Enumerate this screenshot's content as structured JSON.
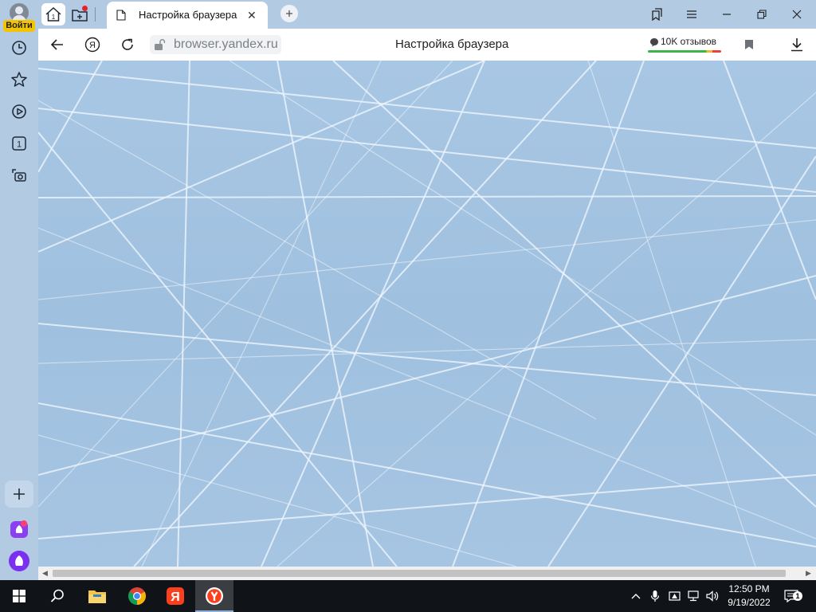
{
  "sidebar": {
    "login_label": "Войти",
    "items": [
      {
        "name": "history-icon"
      },
      {
        "name": "bookmarks-star-icon"
      },
      {
        "name": "play-icon"
      },
      {
        "name": "tabs-counter-icon",
        "label": "1"
      },
      {
        "name": "screenshot-camera-icon"
      }
    ],
    "bottom_items": [
      {
        "name": "add-icon"
      },
      {
        "name": "yandex-messenger-icon"
      },
      {
        "name": "alice-icon"
      }
    ]
  },
  "tabstrip": {
    "active_tab": {
      "title": "Настройка браузера",
      "icon": "page-icon"
    },
    "icons": [
      "home-icon",
      "new-tab-group-icon",
      "new-tab-icon"
    ]
  },
  "window_controls": [
    "collections-icon",
    "menu-icon",
    "minimize-icon",
    "restore-icon",
    "close-icon"
  ],
  "address_bar": {
    "url": "browser.yandex.ru",
    "page_title": "Настройка браузера",
    "reviews_label": "10K отзывов",
    "icons": [
      "back-icon",
      "yandex-icon",
      "reload-icon",
      "lock-icon",
      "bookmark-icon",
      "download-icon"
    ]
  },
  "taskbar": {
    "apps": [
      "windows-start-icon",
      "search-icon",
      "file-explorer-icon",
      "chrome-icon",
      "yandex-app-icon",
      "yandex-browser-icon"
    ],
    "tray": [
      "chevron-up-icon",
      "microphone-icon",
      "network-warning-icon",
      "network-icon",
      "volume-icon"
    ],
    "time": "12:50 PM",
    "date": "9/19/2022",
    "notifications_count": "1"
  },
  "colors": {
    "sidebar_bg": "#b2cbe3",
    "login_badge": "#f5c400",
    "notification_dot": "#e8222b",
    "taskbar_bg": "#101418"
  }
}
